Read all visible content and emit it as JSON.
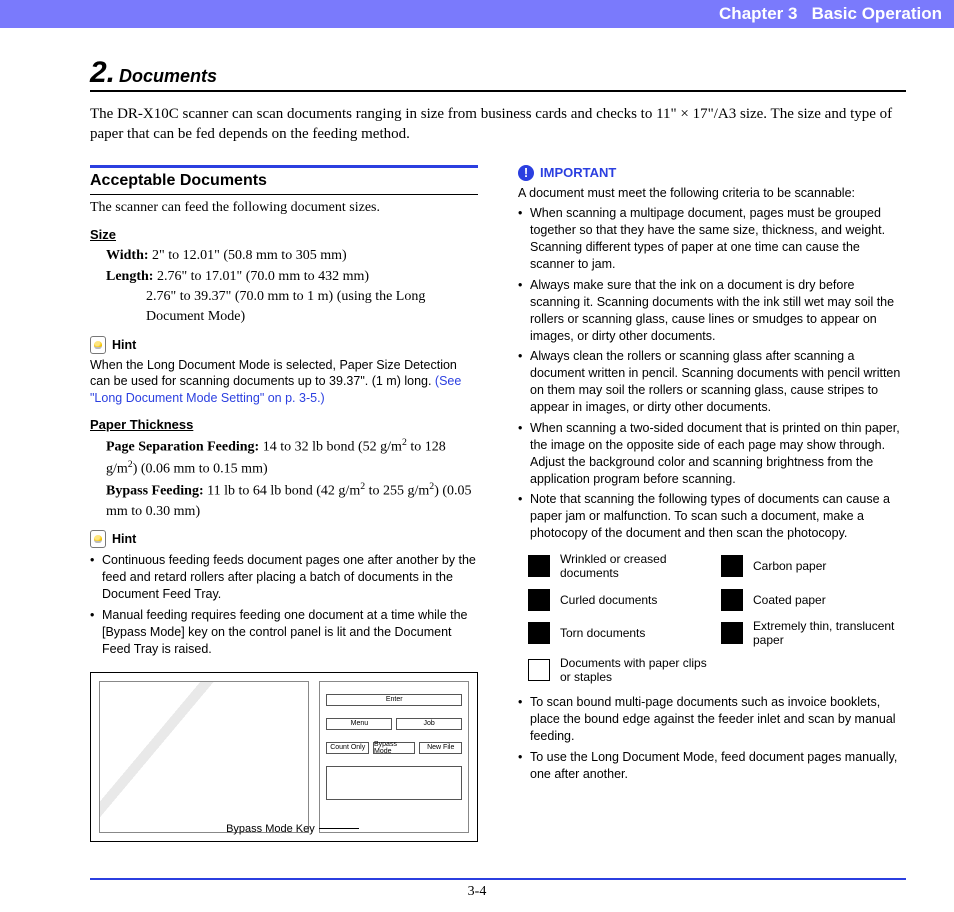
{
  "header": {
    "chapter": "Chapter 3",
    "title": "Basic Operation"
  },
  "section": {
    "number": "2.",
    "label": "Documents"
  },
  "intro": "The DR-X10C scanner can scan documents ranging in size from business cards and checks to 11\" × 17\"/A3 size. The size and type of paper that can be fed depends on the feeding method.",
  "left": {
    "h2": "Acceptable Documents",
    "para": "The scanner can feed the following document sizes.",
    "size_h": "Size",
    "width_label": "Width:",
    "width_val": "2\" to 12.01\" (50.8 mm to 305 mm)",
    "length_label": "Length:",
    "length_val": "2.76\" to 17.01\" (70.0 mm to 432 mm)",
    "length_cont": "2.76\" to 39.37\" (70.0 mm to 1 m) (using the Long Document Mode)",
    "hint_label": "Hint",
    "hint1_text": "When the Long Document Mode is selected, Paper Size Detection can be used for scanning documents up to 39.37\". (1 m) long. ",
    "hint1_link": "(See \"Long Document Mode Setting\" on p. 3-5.)",
    "thick_h": "Paper Thickness",
    "psf_label": "Page Separation Feeding:",
    "psf_val_a": "14 to 32 lb bond (52 g/m",
    "psf_val_b": " to 128 g/m",
    "psf_val_c": ") (0.06 mm to 0.15 mm)",
    "bypass_label": "Bypass Feeding:",
    "bypass_a": "11 lb to 64 lb bond (42 g/m",
    "bypass_b": " to 255 g/m",
    "bypass_c": ") (0.05 mm to 0.30 mm)",
    "hint2_b1": "Continuous feeding feeds document pages one after another by the feed and retard rollers after placing a batch of documents in the Document Feed Tray.",
    "hint2_b2": "Manual feeding requires feeding one document at a time while the [Bypass Mode] key on the control panel is lit and the Document Feed Tray is raised.",
    "diagram_label": "Bypass Mode Key",
    "panel": {
      "enter": "Enter",
      "menu": "Menu",
      "job": "Job",
      "count": "Count Only",
      "bypass": "Bypass Mode",
      "newfile": "New File"
    }
  },
  "right": {
    "imp_label": "IMPORTANT",
    "imp_intro": "A document must meet the following criteria to be scannable:",
    "b1": "When scanning a multipage document, pages must be grouped together so that they have the same size, thickness, and weight. Scanning different types of paper at one time can cause the scanner to jam.",
    "b2": "Always make sure that the ink on a document is dry before scanning it. Scanning documents with the ink still wet may soil the rollers or scanning glass, cause lines or smudges to appear on images, or dirty other documents.",
    "b3": "Always clean the rollers or scanning glass after scanning a document written in pencil. Scanning documents with pencil written on them may soil the rollers or scanning glass, cause stripes to appear in images, or dirty other documents.",
    "b4": "When scanning a two-sided document that is printed on thin paper, the image on the opposite side of each page may show through. Adjust the background color and scanning brightness from the application program before scanning.",
    "b5": "Note that scanning the following types of documents can cause a paper jam or malfunction. To scan such a document, make a photocopy of the document and then scan the photocopy.",
    "doctypes": {
      "d1": "Wrinkled or creased documents",
      "d2": "Carbon paper",
      "d3": "Curled documents",
      "d4": "Coated paper",
      "d5": "Torn documents",
      "d6": "Extremely thin, translucent paper",
      "d7": "Documents with paper clips or staples"
    },
    "b6": "To scan bound multi-page documents such as invoice booklets, place the bound edge against the feeder inlet and scan by manual feeding.",
    "b7": "To use the Long Document Mode, feed document pages manually, one after another."
  },
  "pagenum": "3-4"
}
